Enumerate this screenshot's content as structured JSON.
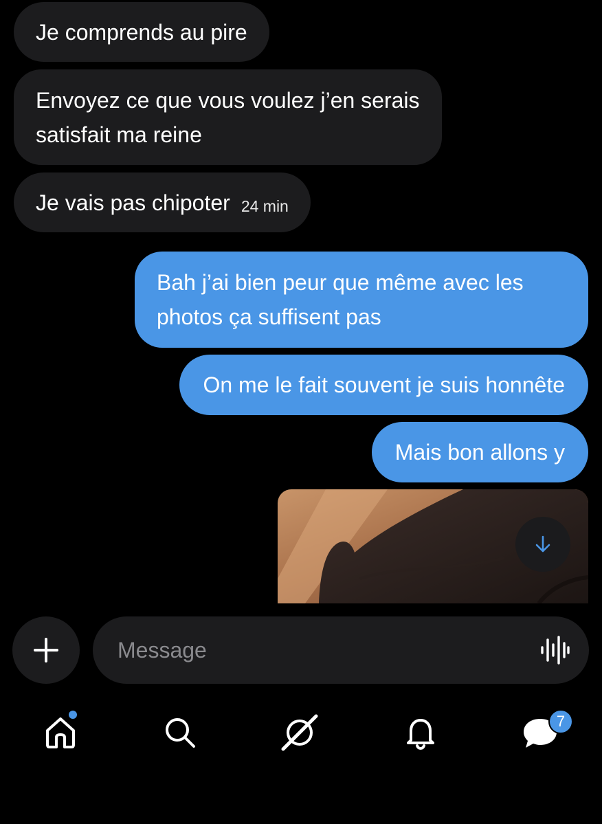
{
  "colors": {
    "background": "#000000",
    "incoming_bubble": "#1c1c1e",
    "outgoing_bubble": "#4a96e6",
    "accent": "#4a96e6",
    "placeholder": "#8a8a8e"
  },
  "messages": [
    {
      "direction": "incoming",
      "lines": [
        "Je comprends au pire"
      ]
    },
    {
      "direction": "incoming",
      "lines": [
        "Envoyez ce que vous voulez j’en serais",
        "satisfait ma reine"
      ]
    },
    {
      "direction": "incoming",
      "lines": [
        "Je vais pas chipoter"
      ],
      "timestamp": "24 min"
    },
    {
      "direction": "outgoing",
      "lines": [
        "Bah j’ai bien peur que même avec les",
        "photos ça suffisent pas"
      ]
    },
    {
      "direction": "outgoing",
      "lines": [
        "On me le fait souvent je suis honnête"
      ]
    },
    {
      "direction": "outgoing",
      "lines": [
        "Mais bon allons y"
      ]
    },
    {
      "direction": "outgoing",
      "type": "photo"
    }
  ],
  "scroll_button": {
    "icon": "arrow-down-icon"
  },
  "composer": {
    "add_icon": "plus-icon",
    "placeholder": "Message",
    "value": "",
    "voice_icon": "voice-waveform-icon"
  },
  "tabbar": {
    "tabs": [
      {
        "name": "home",
        "icon": "home-icon",
        "has_notification_dot": true
      },
      {
        "name": "search",
        "icon": "search-icon"
      },
      {
        "name": "grok",
        "icon": "grok-icon"
      },
      {
        "name": "notifications",
        "icon": "bell-icon"
      },
      {
        "name": "messages",
        "icon": "messages-icon",
        "badge": "7"
      }
    ]
  }
}
